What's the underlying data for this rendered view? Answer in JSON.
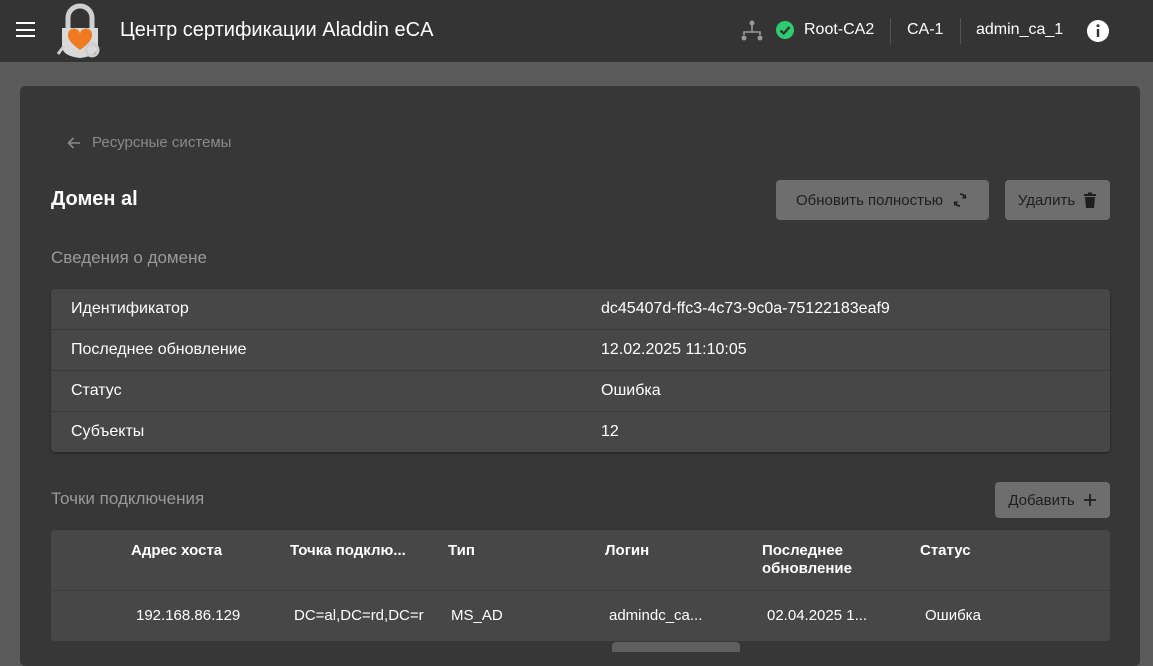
{
  "header": {
    "app_title": "Центр сертификации Aladdin eCA",
    "root_ca": "Root-CA2",
    "ca": "CA-1",
    "user": "admin_ca_1",
    "status_color": "#2ecc71"
  },
  "breadcrumb": {
    "back_label": "Ресурсные системы"
  },
  "page": {
    "title": "Домен al",
    "refresh_label": "Обновить полностью",
    "delete_label": "Удалить"
  },
  "domain_info": {
    "section_title": "Сведения о домене",
    "rows": [
      {
        "key": "Идентификатор",
        "value": "dc45407d-ffc3-4c73-9c0a-75122183eaf9"
      },
      {
        "key": "Последнее обновление",
        "value": "12.02.2025 11:10:05"
      },
      {
        "key": "Статус",
        "value": "Ошибка"
      },
      {
        "key": "Субъекты",
        "value": "12"
      }
    ]
  },
  "connections": {
    "section_title": "Точки подключения",
    "add_label": "Добавить",
    "columns": {
      "host": "Адрес хоста",
      "point": "Точка подклю...",
      "type": "Тип",
      "login": "Логин",
      "updated_1": "Последнее",
      "updated_2": "обновление",
      "status": "Статус"
    },
    "rows": [
      {
        "host": "192.168.86.129",
        "point": "DC=al,DC=rd,DC=r",
        "type": "MS_AD",
        "login": "admindc_ca...",
        "updated": "02.04.2025 1...",
        "status": "Ошибка"
      }
    ]
  }
}
